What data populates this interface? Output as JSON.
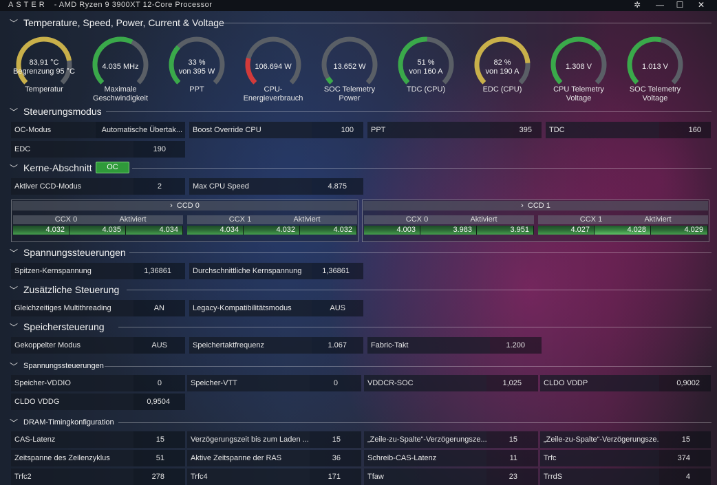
{
  "window": {
    "brand": "ASTER",
    "title": "- AMD Ryzen 9 3900XT 12-Core Processor"
  },
  "sections": {
    "temp": "Temperature, Speed, Power, Current & Voltage",
    "control": "Steuerungsmodus",
    "cores": "Kerne-Abschnitt",
    "voltage": "Spannungssteuerungen",
    "extra": "Zusätzliche Steuerung",
    "memory": "Speichersteuerung",
    "mem_voltage": "Spannungssteuerungen",
    "dram": "DRAM-Timingkonfiguration"
  },
  "gauges": [
    {
      "v1": "83,91 °C",
      "v2": "Begrenzung 95 °C",
      "label": "Temperatur",
      "level": 0.8,
      "color": "#c9b04a"
    },
    {
      "v1": "4.035  MHz",
      "v2": "",
      "label": "Maximale\nGeschwindigkeit",
      "level": 0.6,
      "color": "#3aa94a"
    },
    {
      "v1": "33 %",
      "v2": "von 395 W",
      "label": "PPT",
      "level": 0.33,
      "color": "#3aa94a"
    },
    {
      "v1": "106.694 W",
      "v2": "",
      "label": "CPU-\nEnergieverbrauch",
      "level": 0.22,
      "color": "#d33a3a"
    },
    {
      "v1": "13.652 W",
      "v2": "",
      "label": "SOC Telemetry\nPower",
      "level": 0.05,
      "color": "#3aa94a"
    },
    {
      "v1": "51 %",
      "v2": "von 160 A",
      "label": "TDC (CPU)",
      "level": 0.51,
      "color": "#3aa94a"
    },
    {
      "v1": "82 %",
      "v2": "von 190 A",
      "label": "EDC (CPU)",
      "level": 0.82,
      "color": "#c9b04a"
    },
    {
      "v1": "1.308 V",
      "v2": "",
      "label": "CPU Telemetry\nVoltage",
      "level": 0.7,
      "color": "#3aa94a"
    },
    {
      "v1": "1.013 V",
      "v2": "",
      "label": "SOC Telemetry\nVoltage",
      "level": 0.55,
      "color": "#3aa94a"
    }
  ],
  "control": {
    "oc_mode": {
      "k": "OC-Modus",
      "v": "Automatische Übertak..."
    },
    "boost": {
      "k": "Boost Override CPU",
      "v": "100"
    },
    "ppt": {
      "k": "PPT",
      "v": "395"
    },
    "tdc": {
      "k": "TDC",
      "v": "160"
    },
    "edc": {
      "k": "EDC",
      "v": "190"
    }
  },
  "cores": {
    "badge": "OC",
    "ccd_mode": {
      "k": "Aktiver CCD-Modus",
      "v": "2"
    },
    "max_speed": {
      "k": "Max CPU Speed",
      "v": "4.875"
    },
    "ccds": [
      {
        "name": "CCD 0",
        "ccx": [
          {
            "name": "CCX 0",
            "state": "Aktiviert",
            "cores": [
              "4.032",
              "4.035",
              "4.034"
            ]
          },
          {
            "name": "CCX 1",
            "state": "Aktiviert",
            "cores": [
              "4.034",
              "4.032",
              "4.032"
            ]
          }
        ]
      },
      {
        "name": "CCD 1",
        "ccx": [
          {
            "name": "CCX 0",
            "state": "Aktiviert",
            "cores": [
              "4.003",
              "3.983",
              "3.951"
            ]
          },
          {
            "name": "CCX 1",
            "state": "Aktiviert",
            "cores": [
              "4.027",
              "4.028",
              "4.029"
            ]
          }
        ]
      }
    ]
  },
  "voltage": {
    "peak": {
      "k": "Spitzen-Kernspannung",
      "v": "1,36861"
    },
    "avg": {
      "k": "Durchschnittliche Kernspannung",
      "v": "1,36861"
    }
  },
  "extra": {
    "smt": {
      "k": "Gleichzeitiges Multithreading",
      "v": "AN"
    },
    "legacy": {
      "k": "Legacy-Kompatibilitätsmodus",
      "v": "AUS"
    }
  },
  "memory": {
    "coupled": {
      "k": "Gekoppelter Modus",
      "v": "AUS"
    },
    "freq": {
      "k": "Speichertaktfrequenz",
      "v": "1.067"
    },
    "fabric": {
      "k": "Fabric-Takt",
      "v": "1.200"
    }
  },
  "mem_voltage": {
    "vddio": {
      "k": "Speicher-VDDIO",
      "v": "0"
    },
    "vtt": {
      "k": "Speicher-VTT",
      "v": "0"
    },
    "vddcr": {
      "k": "VDDCR-SOC",
      "v": "1,025"
    },
    "vddp": {
      "k": "CLDO VDDP",
      "v": "0,9002"
    },
    "vddg": {
      "k": "CLDO VDDG",
      "v": "0,9504"
    }
  },
  "dram": [
    [
      {
        "k": "CAS-Latenz",
        "v": "15"
      },
      {
        "k": "Verzögerungszeit bis zum Laden ...",
        "v": "15"
      },
      {
        "k": "„Zeile-zu-Spalte“-Verzögerungsze...",
        "v": "15"
      },
      {
        "k": "„Zeile-zu-Spalte“-Verzögerungsze...",
        "v": "15"
      }
    ],
    [
      {
        "k": "Zeitspanne des Zeilenzyklus",
        "v": "51"
      },
      {
        "k": "Aktive Zeitspanne der RAS",
        "v": "36"
      },
      {
        "k": "Schreib-CAS-Latenz",
        "v": "11"
      },
      {
        "k": "Trfc",
        "v": "374"
      }
    ],
    [
      {
        "k": "Trfc2",
        "v": "278"
      },
      {
        "k": "Trfc4",
        "v": "171"
      },
      {
        "k": "Tfaw",
        "v": "23"
      },
      {
        "k": "TrrdS",
        "v": "4"
      }
    ]
  ]
}
